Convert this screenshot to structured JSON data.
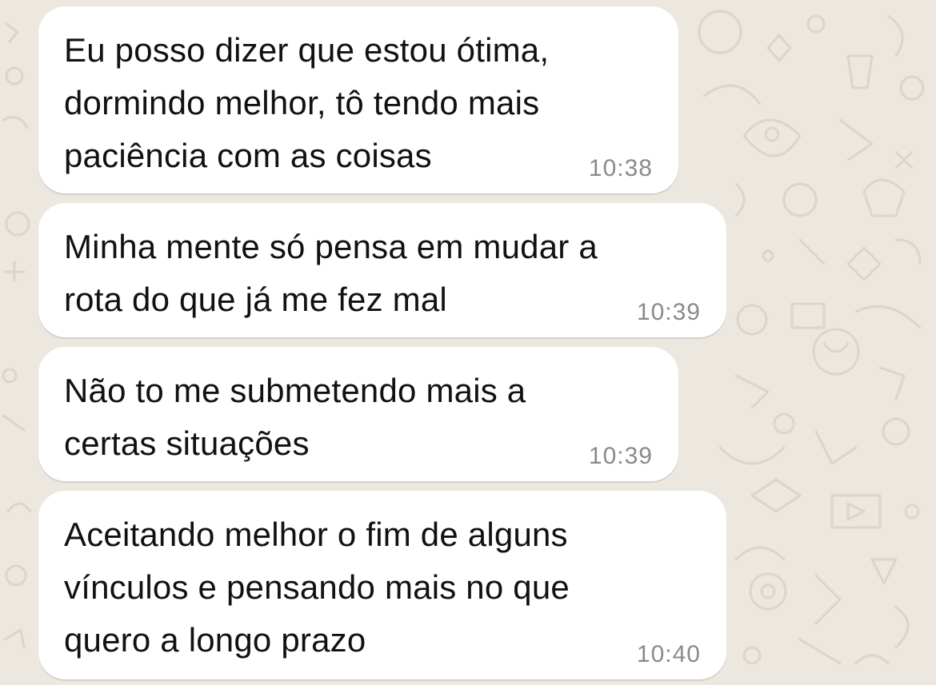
{
  "messages": [
    {
      "text": "Eu posso dizer que estou ótima,\ndormindo melhor, tô tendo mais\npaciência com as coisas",
      "time": "10:38"
    },
    {
      "text": "Minha mente só pensa em mudar a\nrota do que já me fez mal",
      "time": "10:39"
    },
    {
      "text": "Não to me submetendo mais a\ncertas situações",
      "time": "10:39"
    },
    {
      "text": "Aceitando melhor o fim de alguns\nvínculos e pensando mais no que\nquero a longo prazo",
      "time": "10:40"
    }
  ],
  "colors": {
    "background": "#ece7df",
    "bubble": "#ffffff",
    "text": "#111111",
    "time": "#8a8a8a"
  }
}
